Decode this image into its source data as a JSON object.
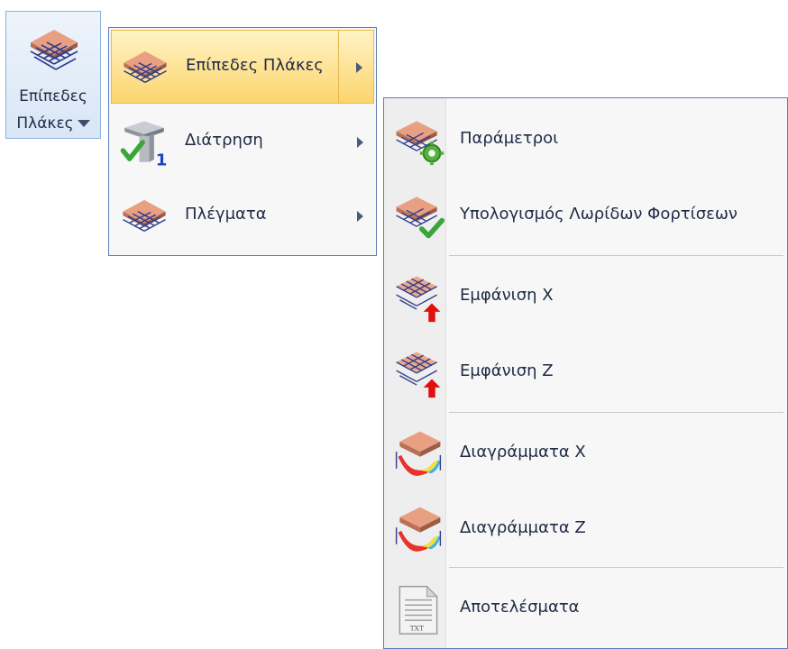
{
  "ribbon_button": {
    "label_line1": "Επίπεδες",
    "label_line2": "Πλάκες",
    "icon": "slab-grid-icon"
  },
  "menu_primary": {
    "items": [
      {
        "label": "Επίπεδες Πλάκες",
        "icon": "slab-grid-icon",
        "highlighted": true,
        "has_submenu": true
      },
      {
        "label": "Διάτρηση",
        "icon": "punching-check-icon",
        "highlighted": false,
        "has_submenu": true
      },
      {
        "label": "Πλέγματα",
        "icon": "mesh-grid-icon",
        "highlighted": false,
        "has_submenu": true
      }
    ]
  },
  "menu_secondary": {
    "items": [
      {
        "label": "Παράμετροι",
        "icon": "slab-gear-icon"
      },
      {
        "label": "Υπολογισμός Λωρίδων Φορτίσεων",
        "icon": "slab-check-icon"
      },
      {
        "label": "Εμφάνιση X",
        "icon": "slab-rebar-up-icon"
      },
      {
        "label": "Εμφάνιση Z",
        "icon": "slab-rebar-up-icon"
      },
      {
        "label": "Διαγράμματα X",
        "icon": "slab-diagram-icon"
      },
      {
        "label": "Διαγράμματα Z",
        "icon": "slab-diagram-icon"
      },
      {
        "label": "Αποτελέσματα",
        "icon": "txt-file-icon"
      }
    ],
    "icon_text_txt": "TXT"
  },
  "colors": {
    "slab_top": "#e9a082",
    "slab_side": "#b87056",
    "grid": "#2f3d8c",
    "highlight_top": "#fff3c4",
    "highlight_bottom": "#fcd56e",
    "menu_border": "#5c7fb5",
    "check_green": "#3aa63a",
    "arrow_red": "#e01010"
  }
}
